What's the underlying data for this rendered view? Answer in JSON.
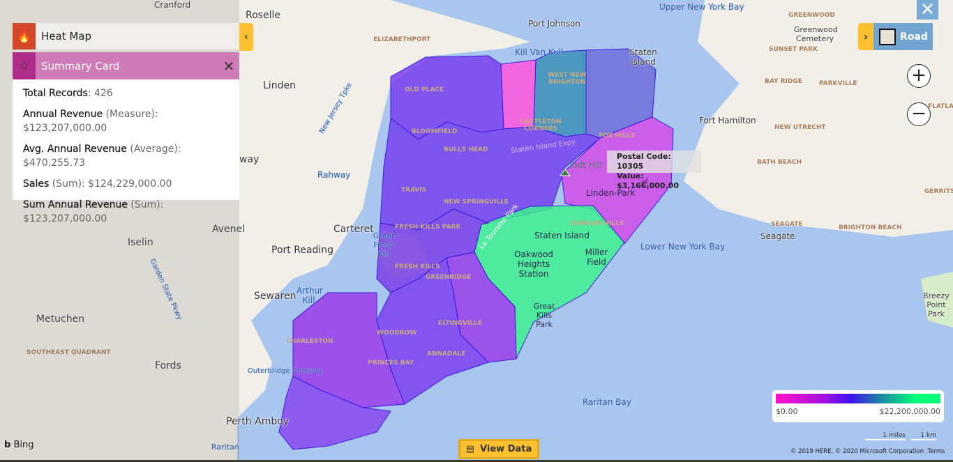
{
  "heat_map_panel": {
    "title": "Heat Map",
    "icon": "fire-icon",
    "color": "#d6472a"
  },
  "summary_card": {
    "title": "Summary Card",
    "icon": "star-icon",
    "color": "#cf7bb8",
    "rows": [
      {
        "label": "Total Records",
        "qualifier": "",
        "value": "426"
      },
      {
        "label": "Annual Revenue",
        "qualifier": "(Measure)",
        "value": "$123,207,000.00"
      },
      {
        "label": "Avg. Annual Revenue",
        "qualifier": "(Average)",
        "value": "$470,255.73"
      },
      {
        "label": "Sales",
        "qualifier": "(Sum)",
        "value": "$124,229,000.00"
      },
      {
        "label": "Sum Annual Revenue",
        "qualifier": "(Sum)",
        "value": "$123,207,000.00"
      }
    ]
  },
  "map_style": {
    "label": "Road"
  },
  "tooltip": {
    "line1": "Postal Code: 10305",
    "line2": "Value: $3,166,000.00"
  },
  "legend": {
    "min": "$0.00",
    "max": "$22,200,000.00",
    "colors": [
      "#ff12c6",
      "#4010f0",
      "#00ff78"
    ]
  },
  "scale": {
    "miles": "1 miles",
    "km": "1 km"
  },
  "copyright": "© 2019 HERE, © 2020 Microsoft Corporation",
  "terms": "Terms",
  "view_data": "View Data",
  "bing": "Bing",
  "map_labels": {
    "roselle": "Roselle",
    "cranford": "Cranford",
    "linden": "Linden",
    "rahway": "Rahway",
    "way": "way",
    "avenel": "Avenel",
    "iselin": "Iselin",
    "carteret": "Carteret",
    "port_reading": "Port Reading",
    "sewaren": "Sewaren",
    "metuchen": "Metuchen",
    "fords": "Fords",
    "perth_amboy": "Perth Amboy",
    "raritan": "Raritan",
    "southeast_quadrant": "Southeast Quadrant",
    "elizabethport": "Elizabethport",
    "port_johnson": "Port Johnson",
    "kill_van_kull": "Kill Van Kull",
    "upper_bay": "Upper New York Bay",
    "staten_island_top": "Staten Island",
    "greenwood": "Greenwood",
    "greenwood_cemetery": "Greenwood Cemetery",
    "sunset_park": "Sunset Park",
    "bay_ridge": "Bay Ridge",
    "parkville": "Parkville",
    "fort_hamilton": "Fort Hamilton",
    "new_utrecht": "New Utrecht",
    "bath_beach": "Bath Beach",
    "seagate_hood": "Seagate",
    "seagate": "Seagate",
    "brighton_beach": "Brighton Beach",
    "lower_bay": "Lower New York Bay",
    "raritan_bay": "Raritan Bay",
    "breezy_point": "Breezy Point Park",
    "gerrits": "Gerritse",
    "flatlands": "Flatlands",
    "old_place": "Old Place",
    "west_new_brighton": "West New Brighton",
    "castleton_corners": "Castleton Corners",
    "fox_hills": "Fox Hills",
    "bloomfield": "Bloomfield",
    "bulls_head": "Bulls Head",
    "si_expy": "Staten Island Expy",
    "todt_hill": "Todt Hill",
    "linden_park": "Linden-Park",
    "travis": "Travis",
    "new_springville": "New Springville",
    "fresh_kills_park": "Fresh Kills Park",
    "great_fresh_kill": "Great Fresh Kill",
    "fresh_kills": "Fresh Kills",
    "greenridge": "Greenridge",
    "dongan_hills": "Dongan Hills",
    "staten_island": "Staten Island",
    "oakwood": "Oakwood Heights Station",
    "miller_field": "Miller Field",
    "great_kills_park": "Great Kills Park",
    "arthur_kill": "Arthur Kill",
    "charleston": "Charleston",
    "woodrow": "Woodrow",
    "eltingville": "Eltingville",
    "annadale": "Annadale",
    "princes_bay": "Princes Bay",
    "outerbridge": "Outerbridge Crossing",
    "la_tourette": "La Tourette Park",
    "nj_turnpike": "New Jersey Tpke",
    "gsp": "Garden State Pkwy"
  }
}
